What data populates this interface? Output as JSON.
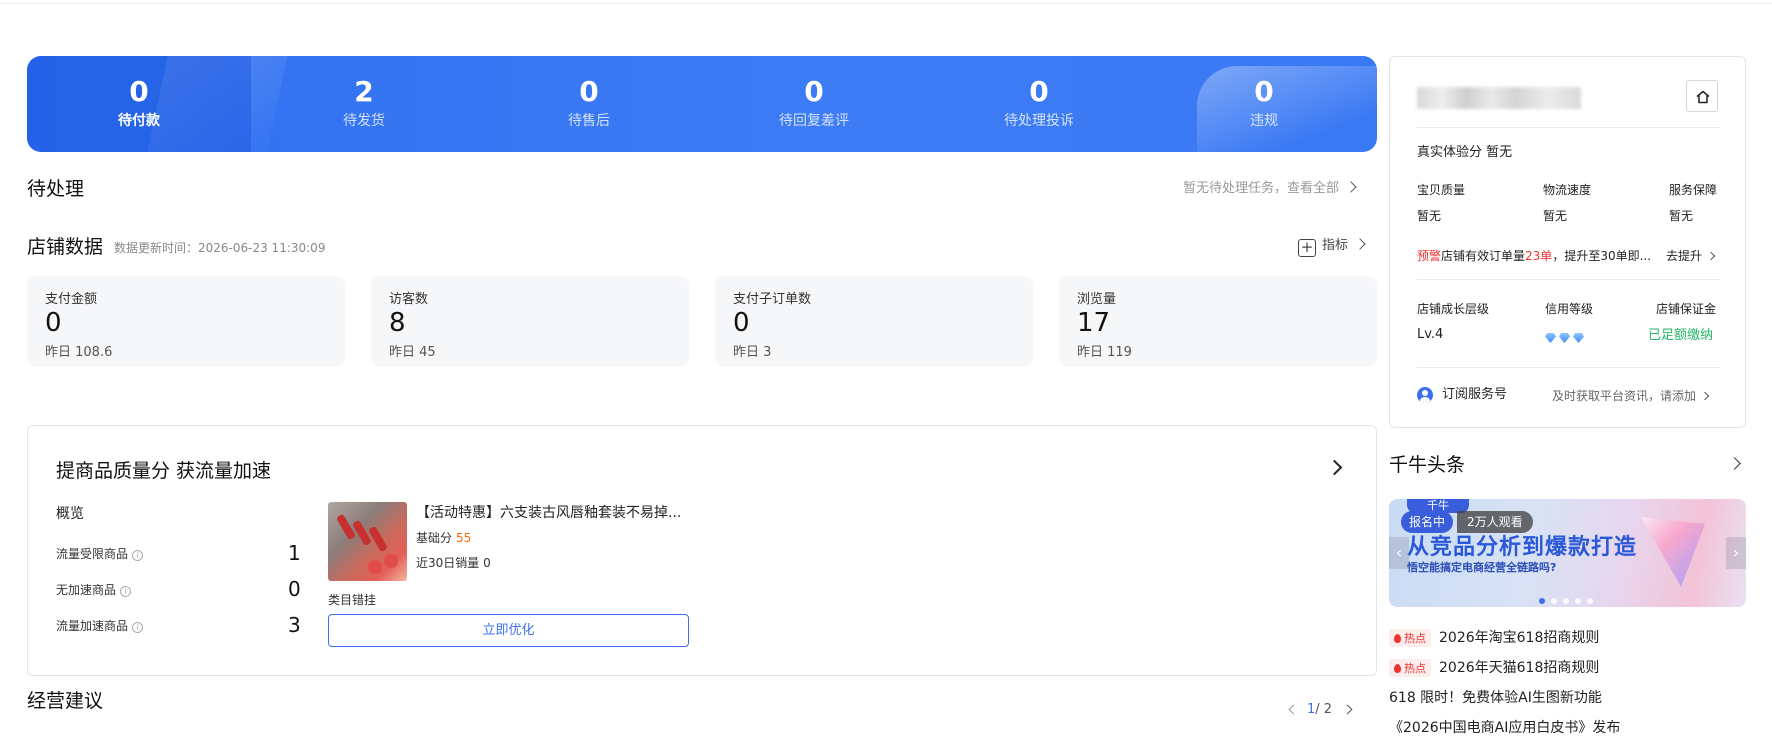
{
  "order_stats": [
    {
      "value": "0",
      "label": "待付款"
    },
    {
      "value": "2",
      "label": "待发货"
    },
    {
      "value": "0",
      "label": "待售后"
    },
    {
      "value": "0",
      "label": "待回复差评"
    },
    {
      "value": "0",
      "label": "待处理投诉"
    },
    {
      "value": "0",
      "label": "违规"
    }
  ],
  "pending": {
    "title": "待处理",
    "link": "暂无待处理任务，查看全部"
  },
  "store_data": {
    "title": "店铺数据",
    "updated": "数据更新时间：2026-06-23 11:30:09",
    "indicator_label": "指标",
    "metrics": [
      {
        "label": "支付金额",
        "value": "0",
        "yesterday": "昨日 108.6"
      },
      {
        "label": "访客数",
        "value": "8",
        "yesterday": "昨日 45"
      },
      {
        "label": "支付子订单数",
        "value": "0",
        "yesterday": "昨日 3"
      },
      {
        "label": "浏览量",
        "value": "17",
        "yesterday": "昨日 119"
      }
    ]
  },
  "quality": {
    "title": "提商品质量分 获流量加速",
    "overview": "概览",
    "rows": [
      {
        "label": "流量受限商品",
        "value": "1"
      },
      {
        "label": "无加速商品",
        "value": "0"
      },
      {
        "label": "流量加速商品",
        "value": "3"
      }
    ],
    "product_title": "【活动特惠】六支装古风唇釉套装不易掉...",
    "score_label": "基础分",
    "score_value": "55",
    "sales": "近30日销量 0",
    "category": "类目错挂",
    "button": "立即优化"
  },
  "advice": {
    "title": "经营建议",
    "page_current": "1",
    "page_total": "/ 2"
  },
  "shop_card": {
    "experience": "真实体验分  暂无",
    "scores": [
      {
        "label": "宝贝质量",
        "value": "暂无"
      },
      {
        "label": "物流速度",
        "value": "暂无"
      },
      {
        "label": "服务保障",
        "value": "暂无"
      }
    ],
    "warning_tag": "预警",
    "warning_a": "店铺有效订单量",
    "warning_num": "23单",
    "warning_b": "，提升至30单即...",
    "warning_action": "去提升",
    "level_label": "店铺成长层级",
    "level_value": "Lv.4",
    "credit_label": "信用等级",
    "deposit_label": "店铺保证金",
    "deposit_value": "已足额缴纳",
    "subscribe_label": "订阅服务号",
    "subscribe_desc": "及时获取平台资讯，请添加"
  },
  "news": {
    "title": "千牛头条",
    "banner": {
      "logo": "千牛",
      "badge": "报名中",
      "count": "2万人观看",
      "headline": "从竞品分析到爆款打造",
      "subline": "悟空能搞定电商经营全链路吗?"
    },
    "hot_tag": "热点",
    "items": [
      {
        "text": "2026年淘宝618招商规则",
        "hot": true
      },
      {
        "text": "2026年天猫618招商规则",
        "hot": true
      },
      {
        "text": "618 限时！免费体验AI生图新功能",
        "hot": false
      },
      {
        "text": "《2026中国电商AI应用白皮书》发布",
        "hot": false
      }
    ]
  },
  "colors": {
    "primary": "#3d7cf4",
    "accent_blue": "#3d6ff0",
    "orange": "#ff6a00",
    "red": "#f23030",
    "green": "#25b76a"
  }
}
